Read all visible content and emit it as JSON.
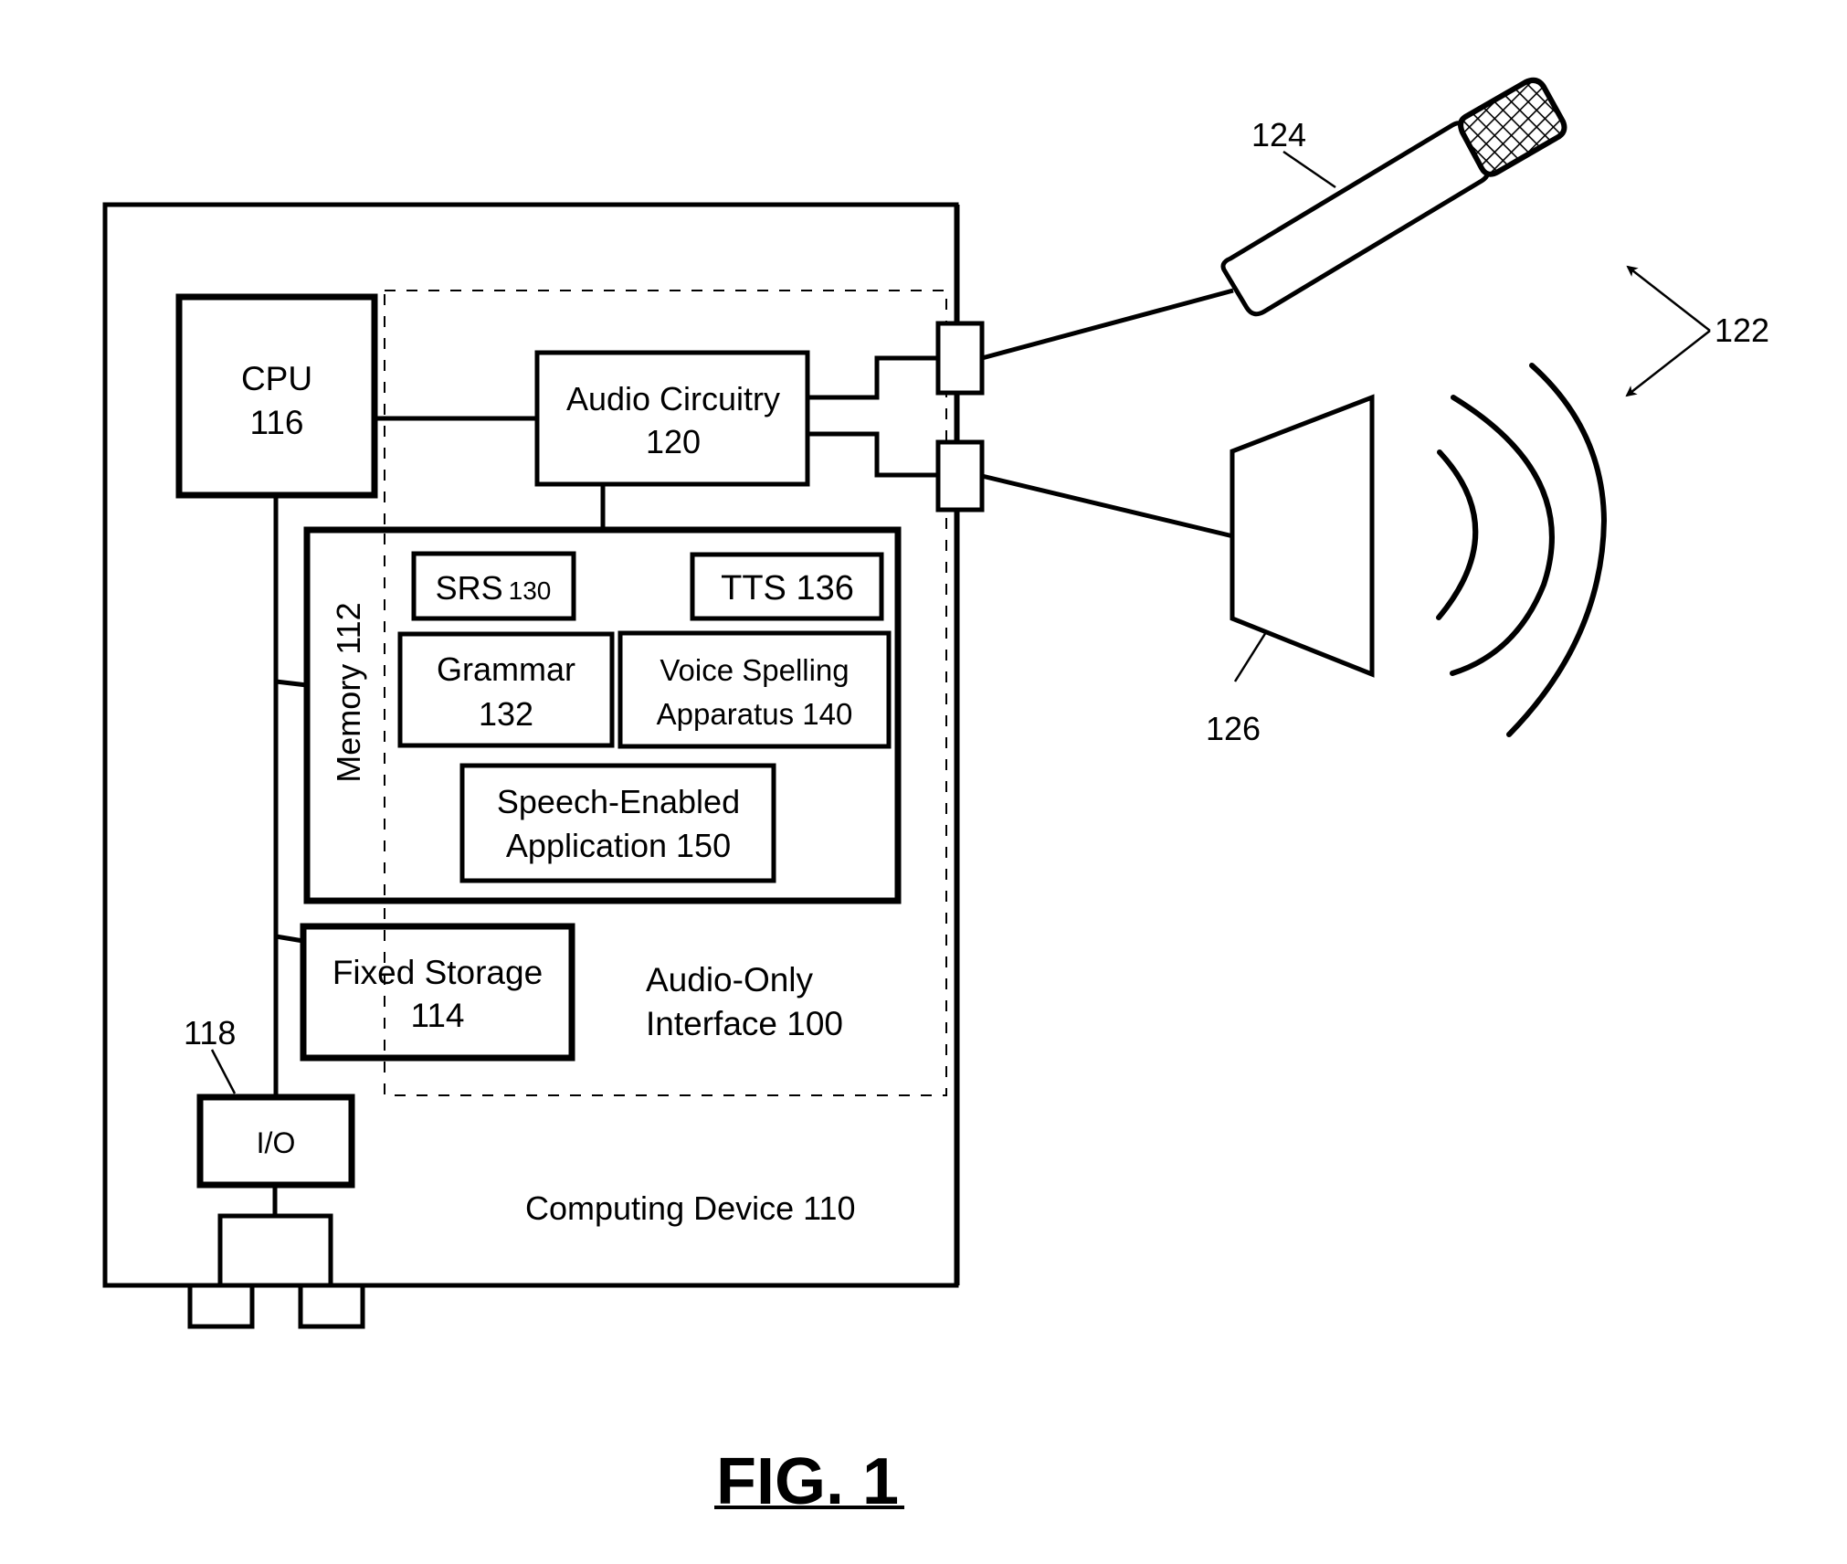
{
  "figure": {
    "caption": "FIG. 1",
    "colors": {
      "ink": "#000000",
      "background": "#ffffff"
    }
  },
  "computing_device": {
    "label": "Computing Device 110"
  },
  "audio_only_interface": {
    "line1": "Audio-Only",
    "line2": "Interface 100"
  },
  "cpu": {
    "line1": "CPU",
    "line2": "116"
  },
  "audio_circuitry": {
    "line1": "Audio Circuitry",
    "line2": "120"
  },
  "memory": {
    "label": "Memory 112",
    "components": {
      "srs": {
        "name": "SRS",
        "ref": "130"
      },
      "tts": {
        "label": "TTS 136"
      },
      "grammar": {
        "line1": "Grammar",
        "line2": "132"
      },
      "voice_spelling": {
        "line1": "Voice Spelling",
        "line2": "Apparatus 140"
      },
      "speech_app": {
        "line1": "Speech-Enabled",
        "line2": "Application 150"
      }
    }
  },
  "fixed_storage": {
    "line1": "Fixed Storage",
    "line2": "114"
  },
  "io": {
    "label": "I/O",
    "ref": "118"
  },
  "external": {
    "microphone_ref": "124",
    "speaker_ref": "126",
    "audio_devices_ref": "122"
  }
}
